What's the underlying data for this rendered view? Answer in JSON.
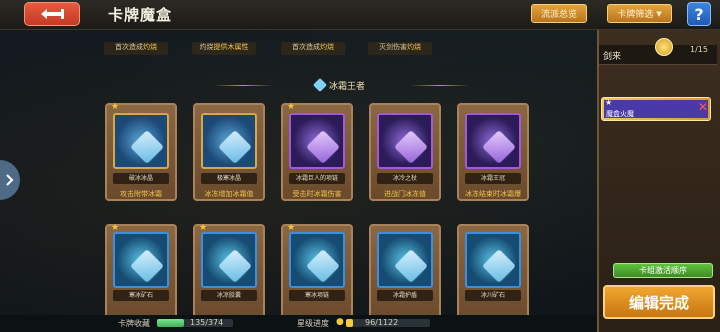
{
  "header": {
    "title": "卡牌魔盒",
    "btn_source": "流派总览",
    "btn_filter": "卡牌筛选",
    "help": "?"
  },
  "partial_row": [
    {
      "prefix": "首次造成",
      "highlight": "灼烧"
    },
    {
      "prefix": "灼烧",
      "highlight": "提供木属性"
    },
    {
      "prefix": "首次造成",
      "highlight": "灼烧"
    },
    {
      "prefix": "灭剑伤害",
      "highlight": "灼烧"
    }
  ],
  "section_title": "冰霜王者",
  "cards_row1": [
    {
      "name": "破冰冰晶",
      "desc": "攻击附带冰霜",
      "tier": "gold",
      "star": true
    },
    {
      "name": "极寒冰晶",
      "desc": "冰冻增加冰霜值",
      "tier": "gold",
      "star": false
    },
    {
      "name": "冰霜巨人的项链",
      "desc": "受击时冰霜伤害",
      "tier": "purple",
      "star": true
    },
    {
      "name": "冰冷之杖",
      "desc": "进战门冰冻值",
      "tier": "purple",
      "star": false
    },
    {
      "name": "冰霜王冠",
      "desc": "冰冻结束时冰霜爆",
      "tier": "purple",
      "star": false
    }
  ],
  "cards_row2": [
    {
      "name": "寒冰矿石",
      "tier": "blue",
      "star": true
    },
    {
      "name": "冰凉胶囊",
      "tier": "blue",
      "star": true
    },
    {
      "name": "寒冰项链",
      "tier": "blue",
      "star": true
    },
    {
      "name": "冰霜护盾",
      "tier": "blue",
      "star": false
    },
    {
      "name": "冰川矿石",
      "tier": "blue",
      "star": false
    }
  ],
  "right_panel": {
    "deck_name": "剑来",
    "deck_count": "1/15",
    "deck_card_label": "魔盒火魔",
    "activate": "卡组激活顺序",
    "done": "编辑完成"
  },
  "status": {
    "collection_label": "卡牌收藏",
    "collection_value": "135/374",
    "collection_fraction": 0.361,
    "star_label": "星级进度",
    "star_value": "96/1122",
    "star_fraction": 0.086
  },
  "colors": {
    "accent_orange": "#e3a33a",
    "back_red": "#d8482f",
    "done_orange": "#f0a72e",
    "activate_green": "#5fc23e",
    "highlight_yellow": "#f0c34a"
  }
}
